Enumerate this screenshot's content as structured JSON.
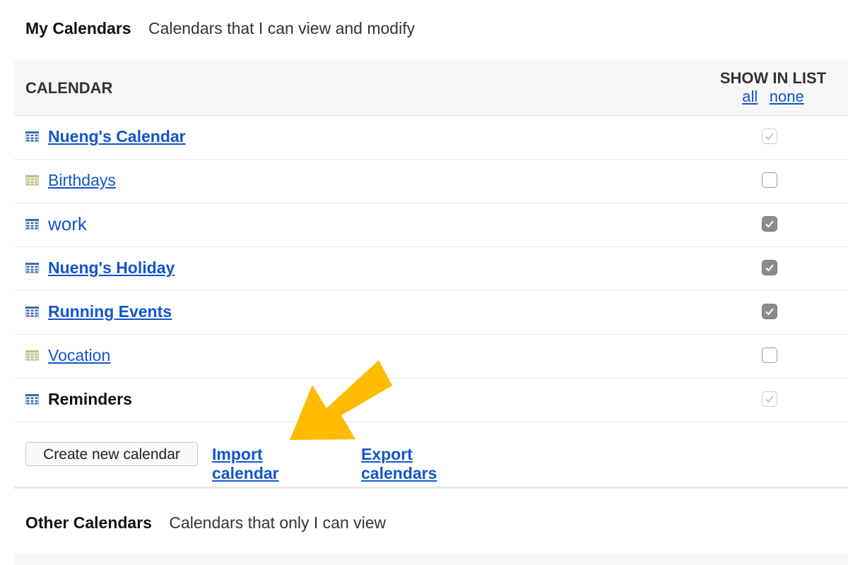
{
  "my_calendars": {
    "title": "My Calendars",
    "description": "Calendars that I can view and modify"
  },
  "table": {
    "col_calendar": "CALENDAR",
    "col_show": "SHOW IN LIST",
    "link_all": "all",
    "link_none": "none"
  },
  "rows": [
    {
      "name": "Nueng's Calendar",
      "style": "bold-link",
      "icon": "calendar-grid-icon-blue",
      "checkbox": "checked-disabled"
    },
    {
      "name": "Birthdays",
      "style": "link",
      "icon": "calendar-grid-icon-beige",
      "checkbox": "unchecked"
    },
    {
      "name": "work",
      "style": "plain",
      "icon": "calendar-grid-icon-blue",
      "checkbox": "checked"
    },
    {
      "name": "Nueng's Holiday",
      "style": "bold-link",
      "icon": "calendar-grid-icon-blue",
      "checkbox": "checked"
    },
    {
      "name": "Running Events",
      "style": "bold-link",
      "icon": "calendar-grid-icon-blue",
      "checkbox": "checked"
    },
    {
      "name": "Vocation",
      "style": "link",
      "icon": "calendar-grid-icon-beige",
      "checkbox": "unchecked"
    },
    {
      "name": "Reminders",
      "style": "static",
      "icon": "calendar-grid-icon-blue",
      "checkbox": "checked-disabled"
    }
  ],
  "actions": {
    "create_label": "Create new calendar",
    "import_label": "Import calendar",
    "export_label": "Export calendars"
  },
  "other_calendars": {
    "title": "Other Calendars",
    "description": "Calendars that only I can view"
  },
  "colors": {
    "link": "#1155cc",
    "arrow": "#ffbb00",
    "icon_blue": "#3d6bb3",
    "icon_beige": "#c9b98a"
  }
}
